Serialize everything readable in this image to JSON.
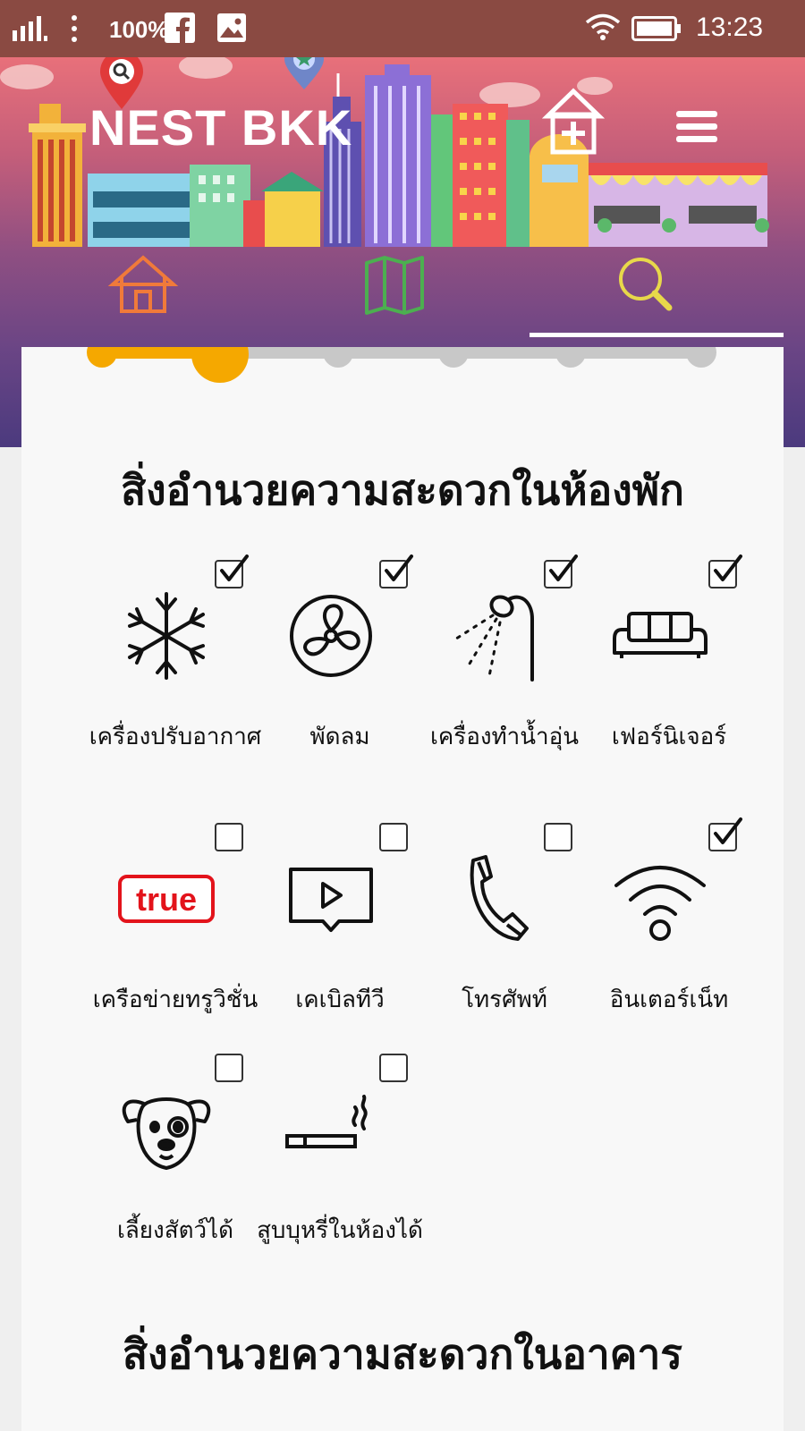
{
  "status_bar": {
    "battery_percent": "100%",
    "time": "13:23"
  },
  "app": {
    "title": "NEST BKK"
  },
  "nav_tabs": [
    {
      "icon": "home-icon"
    },
    {
      "icon": "map-icon"
    },
    {
      "icon": "search-icon"
    }
  ],
  "stepper": {
    "total_steps": 6,
    "current_step": 2
  },
  "room_section": {
    "title": "สิ่งอำนวยความสะดวกในห้องพัก",
    "amenities": [
      {
        "label": "เครื่องปรับอากาศ",
        "icon": "air-conditioner-icon",
        "checked": true
      },
      {
        "label": "พัดลม",
        "icon": "fan-icon",
        "checked": true
      },
      {
        "label": "เครื่องทำน้ำอุ่น",
        "icon": "water-heater-icon",
        "checked": true
      },
      {
        "label": "เฟอร์นิเจอร์",
        "icon": "sofa-icon",
        "checked": true
      },
      {
        "label": "เครือข่ายทรูวิชั่น",
        "icon": "true-logo",
        "checked": false
      },
      {
        "label": "เคเบิลทีวี",
        "icon": "tv-icon",
        "checked": false
      },
      {
        "label": "โทรศัพท์",
        "icon": "phone-icon",
        "checked": false
      },
      {
        "label": "อินเตอร์เน็ท",
        "icon": "wifi-icon",
        "checked": true
      },
      {
        "label": "เลี้ยงสัตว์ได้",
        "icon": "dog-icon",
        "checked": false
      },
      {
        "label": "สูบบุหรี่ในห้องได้",
        "icon": "cigarette-icon",
        "checked": false
      }
    ]
  },
  "building_section": {
    "title": "สิ่งอำนวยความสะดวกในอาคาร"
  },
  "logo_text": "true",
  "colors": {
    "accent": "#f5a800",
    "step_inactive": "#c8c8c8",
    "home_tab": "#f07a3a",
    "map_tab": "#4caf50",
    "search_tab": "#e8d84a"
  }
}
